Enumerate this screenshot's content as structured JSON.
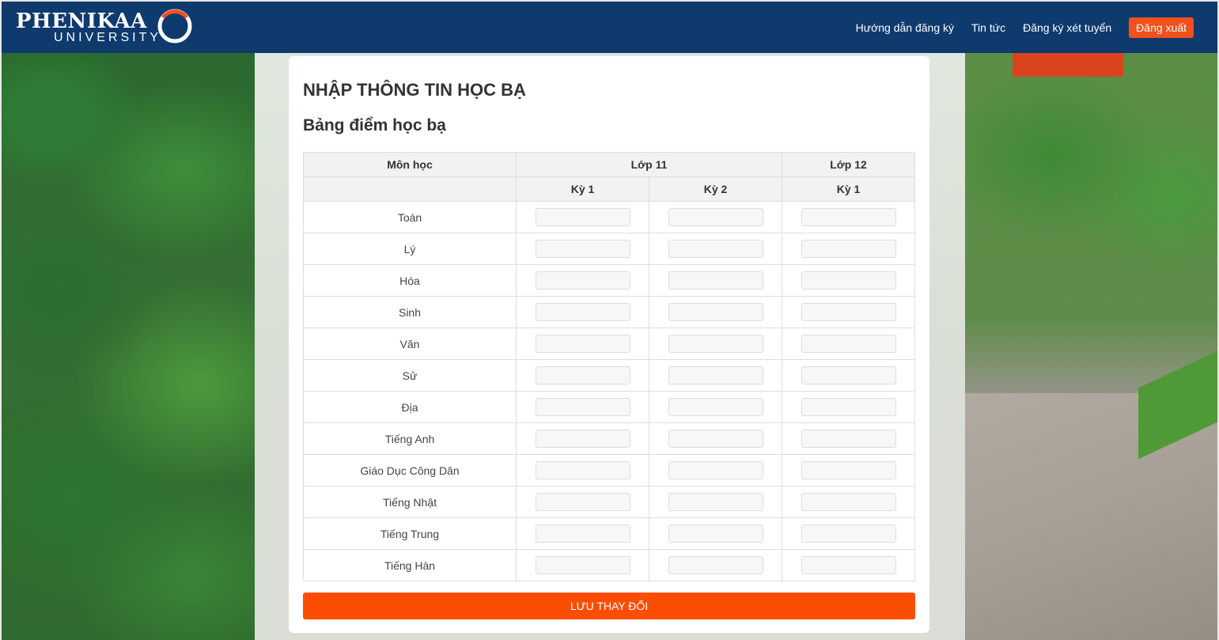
{
  "brand": {
    "name": "PHENIKAA",
    "subtitle": "UNIVERSITY"
  },
  "nav": {
    "links": [
      "Hướng dẫn đăng ký",
      "Tin tức",
      "Đăng ký xét tuyển"
    ],
    "logout": "Đăng xuất"
  },
  "page": {
    "title": "NHẬP THÔNG TIN HỌC BẠ",
    "section": "Bảng điểm học bạ"
  },
  "table": {
    "header_subject": "Môn học",
    "header_grade11": "Lớp 11",
    "header_grade12": "Lớp 12",
    "term_labels": [
      "Kỳ 1",
      "Kỳ 2",
      "Kỳ 1"
    ],
    "subjects": [
      "Toán",
      "Lý",
      "Hóa",
      "Sinh",
      "Văn",
      "Sử",
      "Địa",
      "Tiếng Anh",
      "Giáo Dục Công Dân",
      "Tiếng Nhật",
      "Tiếng Trung",
      "Tiếng Hàn"
    ]
  },
  "save_button": "LƯU THAY ĐỔI",
  "colors": {
    "header_bg": "#0e3a6e",
    "accent": "#fb4d04"
  }
}
